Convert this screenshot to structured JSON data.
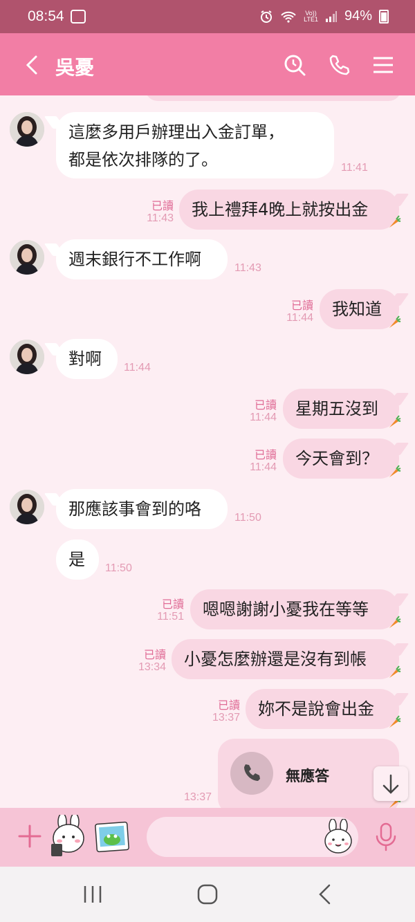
{
  "status_bar": {
    "time": "08:54",
    "lte_top": "Vo))",
    "lte_bottom": "LTE1",
    "battery": "94%"
  },
  "header": {
    "contact_name": "吳憂",
    "back_icon": "chevron-left-icon",
    "search_icon": "search-icon",
    "call_icon": "phone-icon",
    "menu_icon": "menu-icon"
  },
  "messages": [
    {
      "direction": "in",
      "lines": [
        "這麼多用戶辦理出入金訂單，",
        "都是依次排隊的了。"
      ],
      "time": "11:41"
    },
    {
      "direction": "out",
      "text": "我上禮拜4晚上就按出金",
      "read": "已讀",
      "time": "11:43"
    },
    {
      "direction": "in",
      "text": "週末銀行不工作啊",
      "time": "11:43"
    },
    {
      "direction": "out",
      "text": "我知道",
      "read": "已讀",
      "time": "11:44"
    },
    {
      "direction": "in",
      "text": "對啊",
      "time": "11:44"
    },
    {
      "direction": "out",
      "text": "星期五沒到",
      "read": "已讀",
      "time": "11:44"
    },
    {
      "direction": "out",
      "text": "今天會到？",
      "read": "已讀",
      "time": "11:44"
    },
    {
      "direction": "in",
      "text": "那應該事會到的咯",
      "time": "11:50"
    },
    {
      "direction": "in",
      "text": "是",
      "time": "11:50"
    },
    {
      "direction": "out",
      "text": "嗯嗯謝謝小憂我在等等",
      "read": "已讀",
      "time": "11:51"
    },
    {
      "direction": "out",
      "text": "小憂怎麼辦還是沒有到帳",
      "read": "已讀",
      "time": "13:34"
    },
    {
      "direction": "out",
      "text": "妳不是說會出金",
      "read": "已讀",
      "time": "13:37"
    },
    {
      "direction": "out",
      "type": "call",
      "text": "無應答",
      "time": "13:37"
    }
  ],
  "input_bar": {
    "add_icon": "plus-icon",
    "sticker_icon": "sticker-icon",
    "photo_icon": "photo-icon",
    "emoji_icon": "emoji-icon",
    "mic_icon": "microphone-icon"
  },
  "nav_bar": {
    "recents_icon": "recents-icon",
    "home_icon": "home-icon",
    "back_icon": "back-icon"
  },
  "colors": {
    "header": "#f27ea5",
    "status_bar": "#b0536d",
    "chat_bg": "#fdeef3",
    "bubble_out": "#f9d7e3",
    "bubble_in": "#ffffff",
    "read_text": "#e06c96",
    "time_text": "#e39ab3"
  }
}
